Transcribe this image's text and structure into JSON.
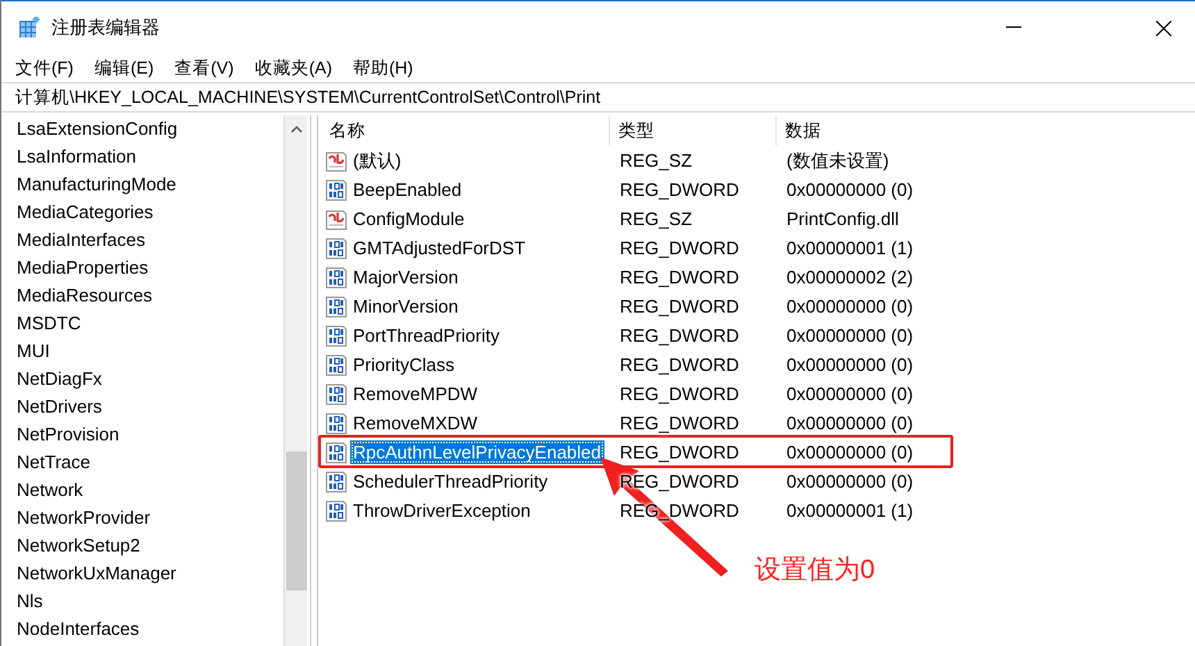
{
  "window": {
    "title": "注册表编辑器"
  },
  "menu": [
    "文件(F)",
    "编辑(E)",
    "查看(V)",
    "收藏夹(A)",
    "帮助(H)"
  ],
  "address": "计算机\\HKEY_LOCAL_MACHINE\\SYSTEM\\CurrentControlSet\\Control\\Print",
  "tree": {
    "items": [
      "LsaExtensionConfig",
      "LsaInformation",
      "ManufacturingMode",
      "MediaCategories",
      "MediaInterfaces",
      "MediaProperties",
      "MediaResources",
      "MSDTC",
      "MUI",
      "NetDiagFx",
      "NetDrivers",
      "NetProvision",
      "NetTrace",
      "Network",
      "NetworkProvider",
      "NetworkSetup2",
      "NetworkUxManager",
      "Nls",
      "NodeInterfaces"
    ]
  },
  "table": {
    "columns": [
      "名称",
      "类型",
      "数据"
    ],
    "rows": [
      {
        "kind": "string",
        "name": "(默认)",
        "type": "REG_SZ",
        "data": "(数值未设置)",
        "selected": false
      },
      {
        "kind": "dword",
        "name": "BeepEnabled",
        "type": "REG_DWORD",
        "data": "0x00000000 (0)",
        "selected": false
      },
      {
        "kind": "string",
        "name": "ConfigModule",
        "type": "REG_SZ",
        "data": "PrintConfig.dll",
        "selected": false
      },
      {
        "kind": "dword",
        "name": "GMTAdjustedForDST",
        "type": "REG_DWORD",
        "data": "0x00000001 (1)",
        "selected": false
      },
      {
        "kind": "dword",
        "name": "MajorVersion",
        "type": "REG_DWORD",
        "data": "0x00000002 (2)",
        "selected": false
      },
      {
        "kind": "dword",
        "name": "MinorVersion",
        "type": "REG_DWORD",
        "data": "0x00000000 (0)",
        "selected": false
      },
      {
        "kind": "dword",
        "name": "PortThreadPriority",
        "type": "REG_DWORD",
        "data": "0x00000000 (0)",
        "selected": false
      },
      {
        "kind": "dword",
        "name": "PriorityClass",
        "type": "REG_DWORD",
        "data": "0x00000000 (0)",
        "selected": false
      },
      {
        "kind": "dword",
        "name": "RemoveMPDW",
        "type": "REG_DWORD",
        "data": "0x00000000 (0)",
        "selected": false
      },
      {
        "kind": "dword",
        "name": "RemoveMXDW",
        "type": "REG_DWORD",
        "data": "0x00000000 (0)",
        "selected": false
      },
      {
        "kind": "dword",
        "name": "RpcAuthnLevelPrivacyEnabled",
        "type": "REG_DWORD",
        "data": "0x00000000 (0)",
        "selected": true
      },
      {
        "kind": "dword",
        "name": "SchedulerThreadPriority",
        "type": "REG_DWORD",
        "data": "0x00000000 (0)",
        "selected": false
      },
      {
        "kind": "dword",
        "name": "ThrowDriverException",
        "type": "REG_DWORD",
        "data": "0x00000001 (1)",
        "selected": false
      }
    ]
  },
  "annotation": {
    "text": "设置值为0"
  }
}
